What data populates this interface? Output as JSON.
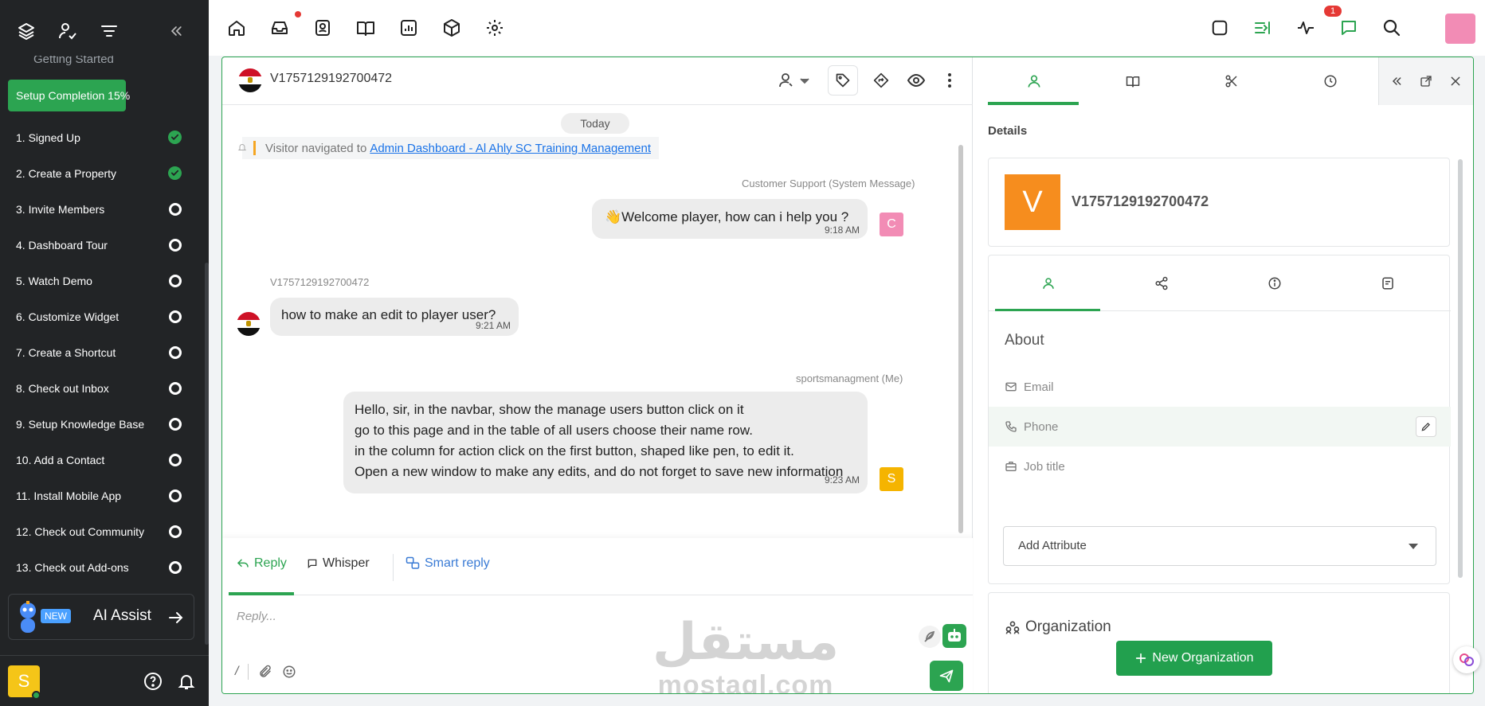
{
  "sidebar": {
    "faded_item": "Getting Started",
    "setup_completion": "Setup Completion 15%",
    "steps": [
      {
        "label": "1. Signed Up",
        "done": true
      },
      {
        "label": "2. Create a Property",
        "done": true
      },
      {
        "label": "3. Invite Members",
        "done": false
      },
      {
        "label": "4. Dashboard Tour",
        "done": false
      },
      {
        "label": "5. Watch Demo",
        "done": false
      },
      {
        "label": "6. Customize Widget",
        "done": false
      },
      {
        "label": "7. Create a Shortcut",
        "done": false
      },
      {
        "label": "8. Check out Inbox",
        "done": false
      },
      {
        "label": "9. Setup Knowledge Base",
        "done": false
      },
      {
        "label": "10. Add a Contact",
        "done": false
      },
      {
        "label": "11. Install Mobile App",
        "done": false
      },
      {
        "label": "12. Check out Community",
        "done": false
      },
      {
        "label": "13. Check out Add-ons",
        "done": false
      }
    ],
    "ai_new_badge": "NEW",
    "ai_assist_label": "AI Assist",
    "user_initial": "S"
  },
  "topbar": {
    "activity_badge": "1",
    "accent": "#2ca451"
  },
  "conversation": {
    "visitor_id": "V1757129192700472",
    "date_separator": "Today",
    "navigation_prefix": "Visitor navigated to",
    "navigation_link": "Admin Dashboard - Al Ahly SC Training Management",
    "messages": [
      {
        "sender": "Customer Support (System Message)",
        "text": "👋Welcome player, how can i help you ?",
        "time": "9:18 AM",
        "avatar": "C",
        "avatar_color": "#f28cb5"
      },
      {
        "sender": "V1757129192700472",
        "text": "how to make an edit to player user?",
        "time": "9:21 AM"
      },
      {
        "sender": "sportsmanagment (Me)",
        "lines": [
          "Hello, sir, in the navbar, show the manage users button click on it",
          "go to this page and in the table of all users choose their name row.",
          "in the column for action click on the first button, shaped like  pen,  to edit it.",
          "Open a new window to make any edits, and do not forget to save new information"
        ],
        "time": "9:23 AM",
        "avatar": "S",
        "avatar_color": "#f5b400"
      }
    ],
    "reply": {
      "tab_reply": "Reply",
      "tab_whisper": "Whisper",
      "tab_smart": "Smart reply",
      "placeholder": "Reply...",
      "slash": "/"
    },
    "watermark_ar": "مستقل",
    "watermark_en": "mostaql.com"
  },
  "details": {
    "section_label": "Details",
    "avatar_initial": "V",
    "visitor_name": "V1757129192700472",
    "about_title": "About",
    "fields": [
      {
        "label": "Email",
        "icon": "mail-icon"
      },
      {
        "label": "Phone",
        "icon": "phone-icon"
      },
      {
        "label": "Job title",
        "icon": "briefcase-icon"
      }
    ],
    "add_attribute": "Add Attribute",
    "organization_title": "Organization",
    "new_organization": "New Organization"
  }
}
